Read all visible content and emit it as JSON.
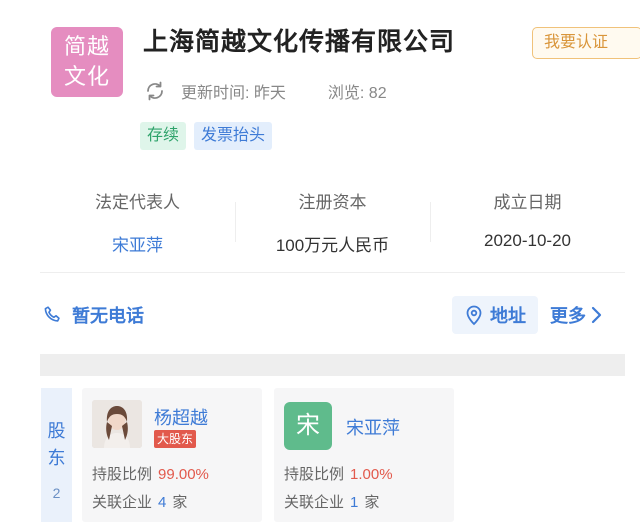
{
  "company": {
    "logo_line1": "简越",
    "logo_line2": "文化",
    "name": "上海简越文化传播有限公司",
    "certify_label": "我要认证",
    "update_time": "更新时间: 昨天",
    "views": "浏览: 82",
    "tags": [
      "存续",
      "发票抬头"
    ]
  },
  "info": [
    {
      "label": "法定代表人",
      "value": "宋亚萍"
    },
    {
      "label": "注册资本",
      "value": "100万元人民币"
    },
    {
      "label": "成立日期",
      "value": "2020-10-20"
    }
  ],
  "contact": {
    "phone": "暂无电话",
    "address": "地址",
    "more": "更多"
  },
  "shareholders": {
    "side_label_1": "股",
    "side_label_2": "东",
    "count": "2",
    "items": [
      {
        "name": "杨超越",
        "badge": "大股东",
        "ratio_label": "持股比例",
        "ratio": "99.00%",
        "related_prefix": "关联企业",
        "related_count": "4",
        "related_suffix": "家"
      },
      {
        "avatar_letter": "宋",
        "name": "宋亚萍",
        "ratio_label": "持股比例",
        "ratio": "1.00%",
        "related_prefix": "关联企业",
        "related_count": "1",
        "related_suffix": "家"
      }
    ]
  },
  "colors": {
    "accent": "#3e7bd6",
    "logo": "#e58dc0",
    "badge": "#e2594c",
    "avatar_green": "#5fbb8c"
  }
}
